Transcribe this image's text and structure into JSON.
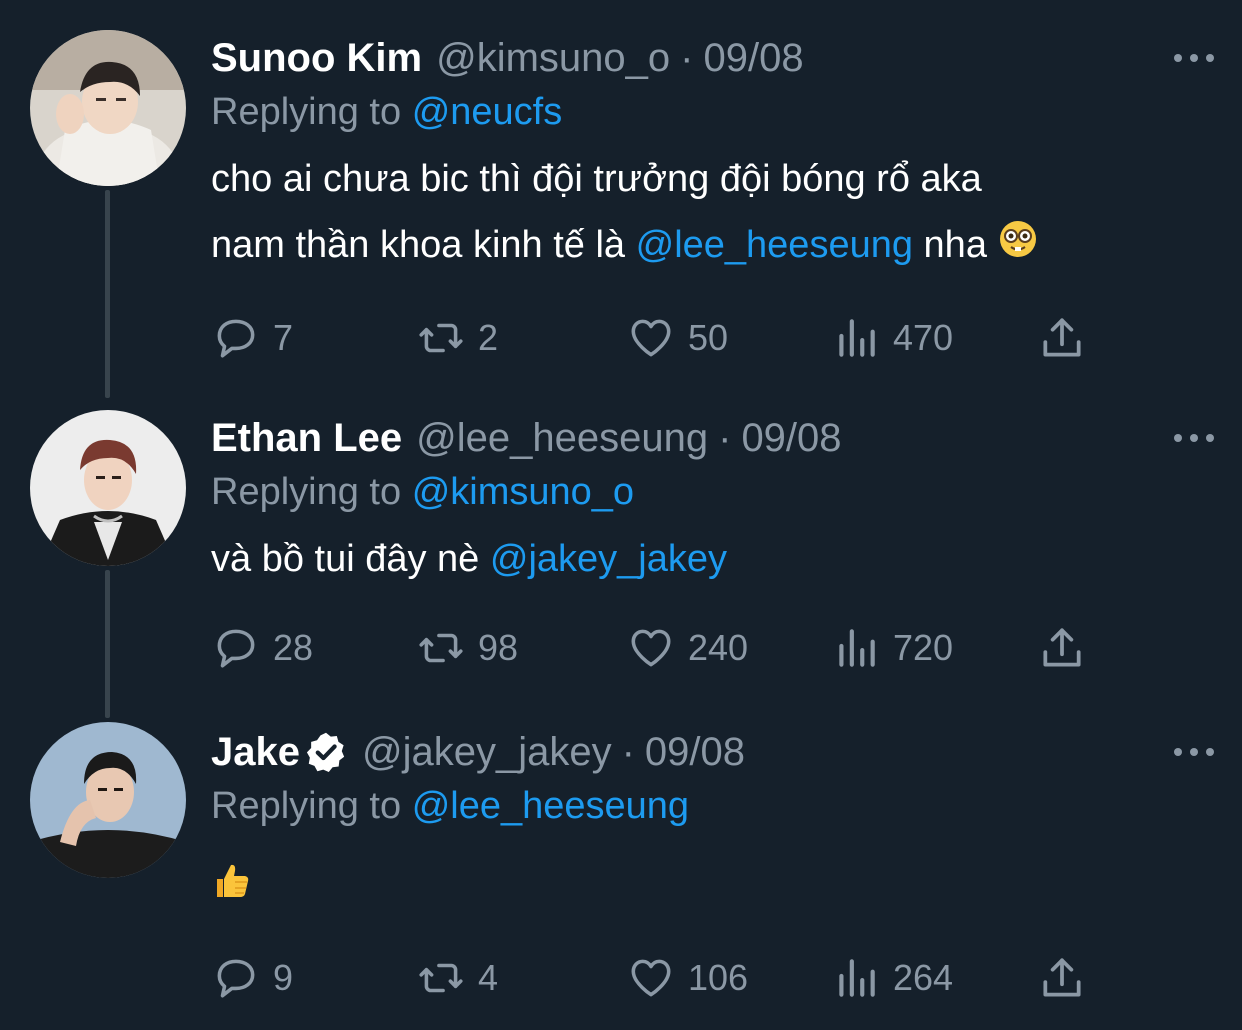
{
  "tweets": [
    {
      "name": "Sunoo Kim",
      "handle": "@kimsuno_o",
      "date": "09/08",
      "replying_prefix": "Replying to",
      "replying_to": "@neucfs",
      "text_line1": "cho ai chưa bic thì đội trưởng đội bóng rổ aka",
      "text_line2_pre": "nam thần khoa kinh tế là",
      "text_line2_mention": "@lee_heeseung",
      "text_line2_post": "nha",
      "emoji": "nerd-face",
      "stats": {
        "replies": "7",
        "retweets": "2",
        "likes": "50",
        "views": "470"
      }
    },
    {
      "name": "Ethan Lee",
      "handle": "@lee_heeseung",
      "date": "09/08",
      "replying_prefix": "Replying to",
      "replying_to": "@kimsuno_o",
      "text_pre": "và bồ tui đây nè",
      "text_mention": "@jakey_jakey",
      "stats": {
        "replies": "28",
        "retweets": "98",
        "likes": "240",
        "views": "720"
      }
    },
    {
      "name": "Jake",
      "verified": true,
      "handle": "@jakey_jakey",
      "date": "09/08",
      "replying_prefix": "Replying to",
      "replying_to": "@lee_heeseung",
      "emoji": "thumbs-up",
      "stats": {
        "replies": "9",
        "retweets": "4",
        "likes": "106",
        "views": "264"
      }
    }
  ],
  "separator": "·",
  "colors": {
    "background": "#15202b",
    "text": "#ffffff",
    "muted": "#8b98a5",
    "link": "#1d9bf0",
    "thread_line": "#38444d"
  },
  "icons": [
    "reply-icon",
    "retweet-icon",
    "like-icon",
    "views-icon",
    "share-icon",
    "more-icon",
    "verified-badge-icon"
  ]
}
